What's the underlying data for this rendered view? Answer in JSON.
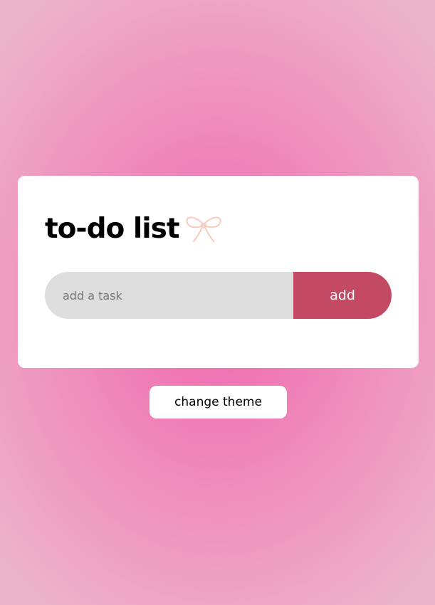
{
  "app": {
    "title": "to-do list",
    "title_icon": "ribbon-bow-icon",
    "title_icon_color": "#f6cfc3"
  },
  "task_form": {
    "input_value": "",
    "input_placeholder": "add a task",
    "add_label": "add"
  },
  "theme": {
    "change_label": "change theme"
  },
  "colors": {
    "background_center": "#ef65ae",
    "background_edge": "#ecb4c8",
    "card": "#ffffff",
    "input_bg": "#dddddd",
    "accent": "#c34a62"
  }
}
